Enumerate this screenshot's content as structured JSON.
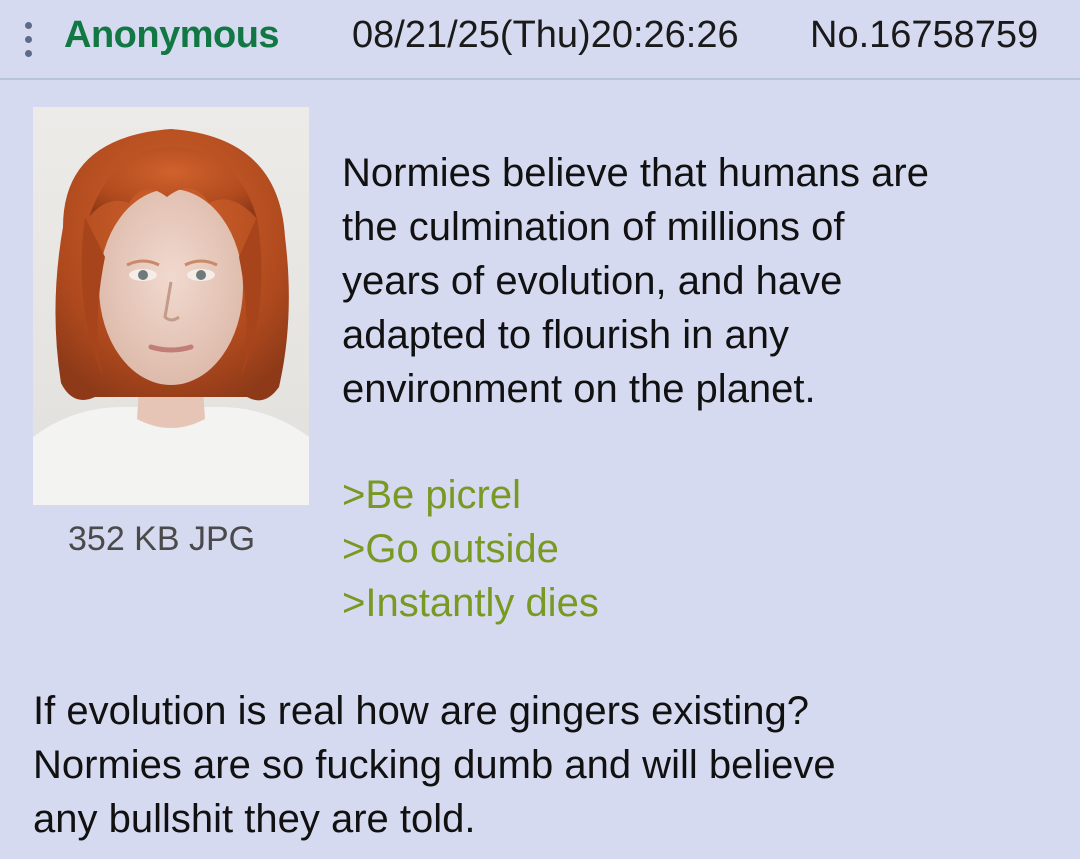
{
  "header": {
    "menu_icon": "kebab-menu-icon",
    "name": "Anonymous",
    "datetime": "08/21/25(Thu)20:26:26",
    "post_number": "No.16758759"
  },
  "attachment": {
    "file_info": "352 KB JPG"
  },
  "comment": {
    "intro_lines": [
      "Normies believe that humans are",
      "the culmination of millions of",
      "years of evolution, and have",
      "adapted to flourish in any",
      "environment on the planet."
    ],
    "greentext": [
      ">Be picrel",
      ">Go outside",
      ">Instantly dies"
    ],
    "closing_lines": [
      "If evolution is real how are gingers existing?",
      "Normies are so fucking dumb and will believe",
      "any bullshit they are told."
    ]
  },
  "colors": {
    "background": "#d6daf0",
    "name": "#117743",
    "greentext": "#789922",
    "text": "#111111"
  }
}
